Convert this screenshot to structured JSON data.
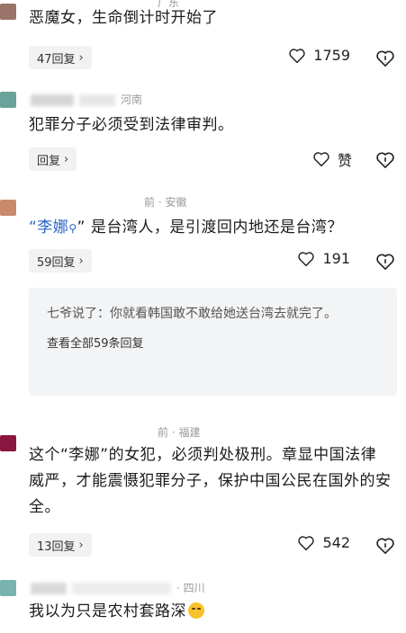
{
  "comments": [
    {
      "location": "广东",
      "text": "恶魔女，生命倒计时开始了",
      "reply_label": "47回复",
      "like_count": "1759"
    },
    {
      "location": "河南",
      "text": "犯罪分子必须受到法律审判。",
      "reply_label": "回复",
      "like_label": "赞"
    },
    {
      "location": "前 · 安徽",
      "mention": "“李娜",
      "mention_end": "”",
      "text": "是台湾人，是引渡回内地还是台湾？",
      "reply_label": "59回复",
      "like_count": "191",
      "quoted_reply": {
        "text": "七爷说了：你就看韩国敢不敢给她送台湾去就完了。",
        "view_all": "查看全部59条回复"
      }
    },
    {
      "location": "前 · 福建",
      "text": "这个“李娜”的女犯，必须判处极刑。章显中国法律威严，才能震慑犯罪分子，保护中国公民在国外的安全。",
      "reply_label": "13回复",
      "like_count": "542"
    },
    {
      "location": "· 四川",
      "text": "我以为只是农村套路深"
    }
  ],
  "icons": {
    "heart": "heart-icon",
    "dislike": "thumbs-down-heart-icon",
    "chevron": "chevron-right-icon",
    "search": "search-icon"
  },
  "colors": {
    "mention": "#2b64c5",
    "avatar_1": "#9a7468",
    "avatar_2": "#6aa39a",
    "avatar_3": "#c98a6c",
    "avatar_4": "#8a1640",
    "avatar_5": "#79b3b0"
  }
}
